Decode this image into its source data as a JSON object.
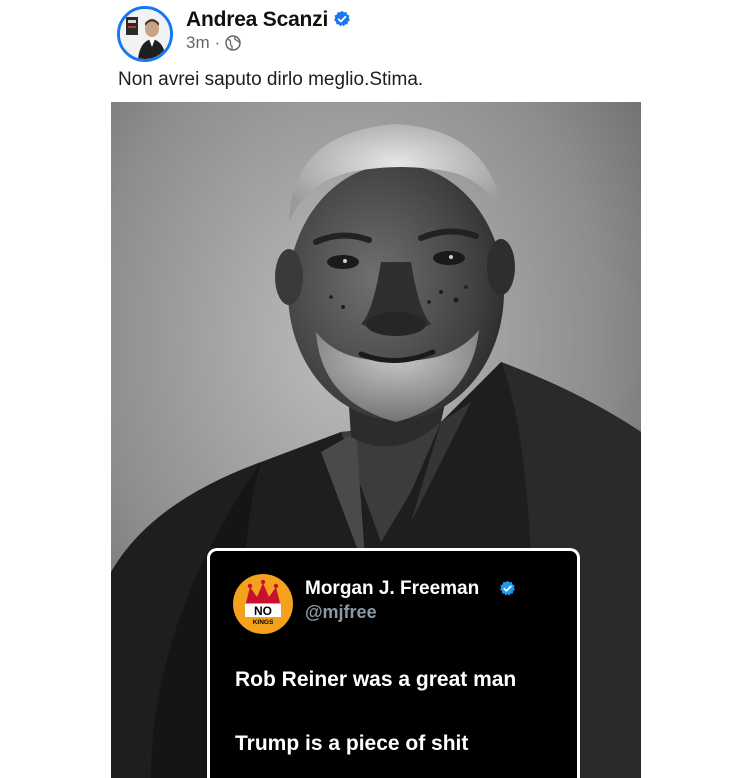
{
  "post": {
    "author_name": "Andrea Scanzi",
    "time": "3m",
    "separator": "·",
    "caption": "Non avrei saputo dirlo meglio.Stima."
  },
  "icons": {
    "verified": "verified-badge-icon",
    "audience": "globe-icon"
  },
  "tweet": {
    "name": "Morgan J. Freeman",
    "handle": "@mjfree",
    "lines": [
      "Rob Reiner was a great man",
      "Trump is a piece of shit"
    ],
    "avatar_text_top": "NO",
    "avatar_text_bottom": "KINGS"
  },
  "colors": {
    "brand_blue": "#1877f2",
    "twitter_blue": "#1d9bf0",
    "tweet_bg": "#000000",
    "no_kings_orange": "#f4a21d",
    "no_kings_red": "#c8102e"
  }
}
